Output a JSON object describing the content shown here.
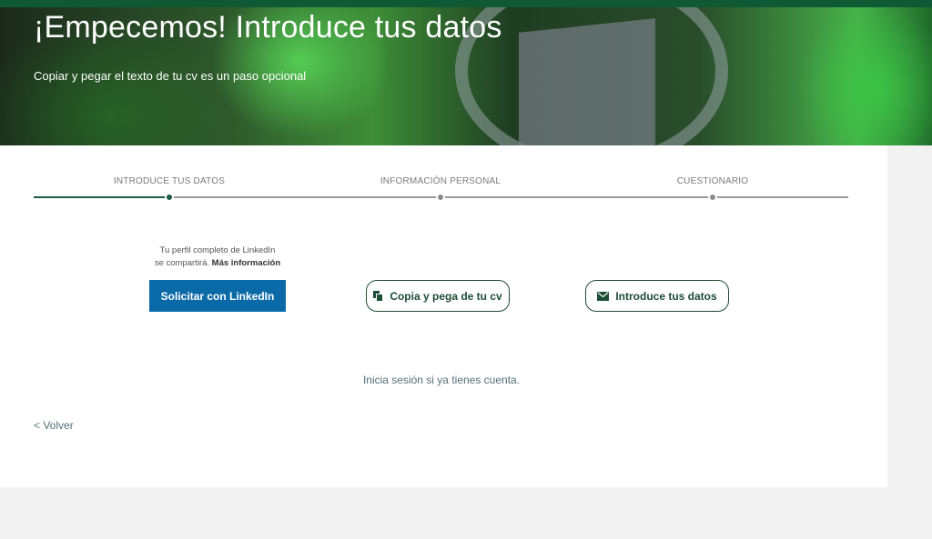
{
  "hero": {
    "title": "¡Empecemos! Introduce tus datos",
    "subtitle": "Copiar y pegar el texto de tu cv es un paso opcional"
  },
  "steps": [
    {
      "label": "INTRODUCE TUS DATOS",
      "active": true
    },
    {
      "label": "INFORMACIÓN PERSONAL",
      "active": false
    },
    {
      "label": "CUESTIONARIO",
      "active": false
    }
  ],
  "linkedin": {
    "note_line1": "Tu perfil completo de LinkedIn",
    "note_line2": "se compartirá.",
    "note_link": "Más información",
    "button_label": "Solicitar con LinkedIn"
  },
  "options": {
    "paste_cv_label": "Copia y pega de tu cv",
    "paste_cv_icon": "copy-icon",
    "manual_label": "Introduce tus datos",
    "manual_icon": "envelope-icon"
  },
  "login_text": "Inicia sesión si ya tienes cuenta.",
  "back_label": "< Volver",
  "colors": {
    "brand_green": "#1c5c40",
    "linkedin_blue": "#0a6aa8",
    "link_text": "#54707a"
  }
}
